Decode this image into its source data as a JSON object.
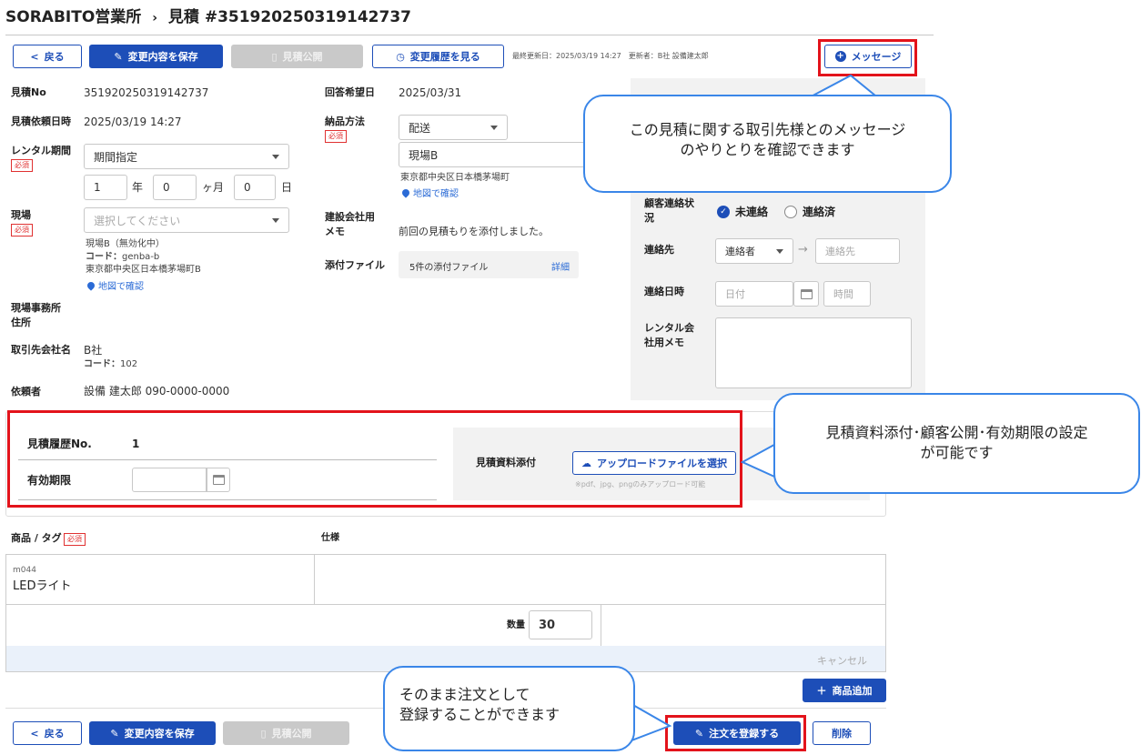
{
  "header": {
    "breadcrumb_root": "SORABITO営業所",
    "separator": "›",
    "title": "見積 #351920250319142737"
  },
  "toolbar": {
    "back": "戻る",
    "save": "変更内容を保存",
    "publish": "見積公開",
    "history": "変更履歴を見る",
    "last_updated": "最終更新日：2025/03/19 14:27　更新者：B社 設備建太郎",
    "message": "メッセージ"
  },
  "left": {
    "quote_no_label": "見積No",
    "quote_no": "351920250319142737",
    "request_dt_label": "見積依頼日時",
    "request_dt": "2025/03/19 14:27",
    "rental_period_label": "レンタル期間",
    "required": "必須",
    "period_type": "期間指定",
    "years": "1",
    "years_unit": "年",
    "months": "0",
    "months_unit": "ヶ月",
    "days": "0",
    "days_unit": "日",
    "site_label": "現場",
    "site_placeholder": "選択してください",
    "site_name": "現場B（無効化中）",
    "site_code_label": "コード：",
    "site_code": "genba-b",
    "site_address": "東京都中央区日本橋茅場町B",
    "map_link": "地図で確認",
    "site_office_label_1": "現場事務所",
    "site_office_label_2": "住所",
    "client_label": "取引先会社名",
    "client_name": "B社",
    "client_code_label": "コード：",
    "client_code": "102",
    "requester_label": "依頼者",
    "requester": "設備 建太郎 090-0000-0000"
  },
  "middle": {
    "reply_date_label": "回答希望日",
    "reply_date": "2025/03/31",
    "delivery_label": "納品方法",
    "delivery": "配送",
    "site_value": "現場B",
    "address": "東京都中央区日本橋茅場町",
    "map_link": "地図で確認",
    "memo_label_1": "建設会社用",
    "memo_label_2": "メモ",
    "memo": "前回の見積もりを添付しました。",
    "attach_label": "添付ファイル",
    "attach_value": "5件の添付ファイル",
    "attach_detail": "詳細"
  },
  "right": {
    "contact_status_label_1": "顧客連絡状",
    "contact_status_label_2": "況",
    "status_uncontacted": "未連絡",
    "status_contacted": "連絡済",
    "contact_label": "連絡先",
    "contact_type": "連絡者",
    "contact_placeholder": "連絡先",
    "contact_dt_label": "連絡日時",
    "date_placeholder": "日付",
    "time_placeholder": "時間",
    "rental_memo_label_1": "レンタル会",
    "rental_memo_label_2": "社用メモ"
  },
  "history": {
    "no_label": "見積履歴No.",
    "no": "1",
    "expiry_label": "有効期限",
    "docs_label": "見積資料添付",
    "upload": "アップロードファイルを選択",
    "upload_hint": "※pdf、jpg、pngのみアップロード可能"
  },
  "items": {
    "product_label": "商品 / タグ",
    "spec_label": "仕様",
    "code": "m044",
    "name": "LEDライト",
    "qty_label": "数量",
    "qty": "30",
    "cancel": "キャンセル",
    "add": "商品追加"
  },
  "bottom": {
    "back": "戻る",
    "save": "変更内容を保存",
    "publish": "見積公開",
    "order": "注文を登録する",
    "delete": "削除"
  },
  "callouts": {
    "message_1": "この見積に関する取引先様とのメッセージ",
    "message_2": "のやりとりを確認できます",
    "quote_1": "見積資料添付･顧客公開･有効期限の設定",
    "quote_2": "が可能です",
    "order_1": "そのまま注文として",
    "order_2": "登録することができます"
  },
  "colors": {
    "primary": "#1d4eb8",
    "highlight": "#e3131b",
    "callout": "#3a86e8"
  }
}
